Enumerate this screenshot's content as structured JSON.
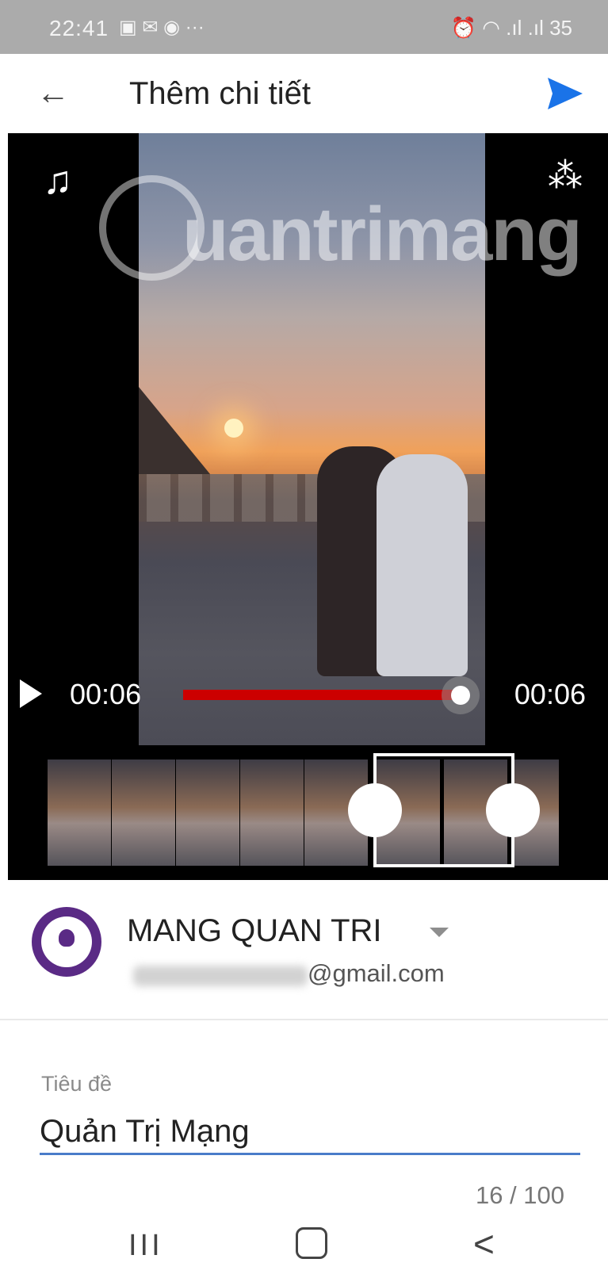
{
  "status_bar": {
    "time": "22:41",
    "left_icons": "▣ ✉ ◉ ···",
    "right_text": "⏰ ◠ .ıl .ıl 35"
  },
  "app_bar": {
    "title": "Thêm chi tiết",
    "back_icon": "←",
    "send_icon": "send-icon"
  },
  "video": {
    "watermark": "uantrimang",
    "music_icon": "♫",
    "magic_icon": "⁂",
    "current_time": "00:06",
    "duration": "00:06",
    "progress_fraction": 1.0
  },
  "account": {
    "name": "MANG QUAN TRI",
    "email_suffix": "@gmail.com"
  },
  "title_field": {
    "label": "Tiêu đề",
    "value": "Quản Trị Mạng",
    "counter": "16 / 100"
  },
  "nav": {
    "recents": "III",
    "back": "<"
  },
  "colors": {
    "accent": "#1a73e8",
    "progress": "#cc0000",
    "avatar": "#5a2a85",
    "input_underline": "#4a7cc9"
  }
}
